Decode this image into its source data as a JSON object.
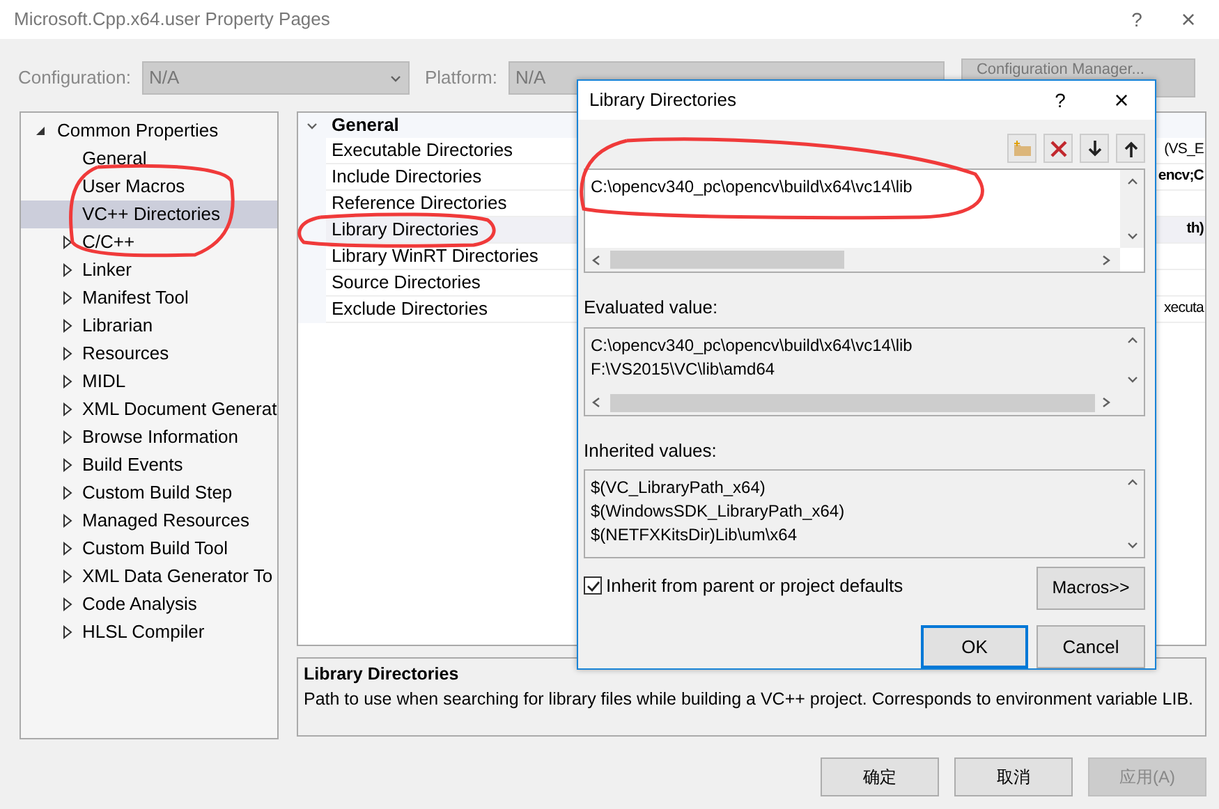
{
  "window": {
    "title": "Microsoft.Cpp.x64.user Property Pages",
    "help": "?",
    "close": "×"
  },
  "config_bar": {
    "configuration_label": "Configuration:",
    "configuration_value": "N/A",
    "platform_label": "Platform:",
    "platform_value": "N/A",
    "manager_button": "Configuration Manager...",
    "disabled": true
  },
  "tree": {
    "label": "Common Properties",
    "expanded": true,
    "children": [
      {
        "label": "General",
        "has_children": false,
        "selected": false
      },
      {
        "label": "User Macros",
        "has_children": false,
        "selected": false
      },
      {
        "label": "VC++ Directories",
        "has_children": false,
        "selected": true
      },
      {
        "label": "C/C++",
        "has_children": true,
        "selected": false
      },
      {
        "label": "Linker",
        "has_children": true,
        "selected": false
      },
      {
        "label": "Manifest Tool",
        "has_children": true,
        "selected": false
      },
      {
        "label": "Librarian",
        "has_children": true,
        "selected": false
      },
      {
        "label": "Resources",
        "has_children": true,
        "selected": false
      },
      {
        "label": "MIDL",
        "has_children": true,
        "selected": false
      },
      {
        "label": "XML Document Generat",
        "has_children": true,
        "selected": false
      },
      {
        "label": "Browse Information",
        "has_children": true,
        "selected": false
      },
      {
        "label": "Build Events",
        "has_children": true,
        "selected": false
      },
      {
        "label": "Custom Build Step",
        "has_children": true,
        "selected": false
      },
      {
        "label": "Managed Resources",
        "has_children": true,
        "selected": false
      },
      {
        "label": "Custom Build Tool",
        "has_children": true,
        "selected": false
      },
      {
        "label": "XML Data Generator To",
        "has_children": true,
        "selected": false
      },
      {
        "label": "Code Analysis",
        "has_children": true,
        "selected": false
      },
      {
        "label": "HLSL Compiler",
        "has_children": true,
        "selected": false
      }
    ]
  },
  "grid": {
    "category": "General",
    "expanded": true,
    "rows": [
      {
        "name": "Executable Directories",
        "value": "(VS_E",
        "bold": false,
        "selected": false
      },
      {
        "name": "Include Directories",
        "value": "encv;C",
        "bold": true,
        "selected": false
      },
      {
        "name": "Reference Directories",
        "selected": false
      },
      {
        "name": "Library Directories",
        "value": "th)",
        "bold": true,
        "selected": true
      },
      {
        "name": "Library WinRT Directories",
        "selected": false
      },
      {
        "name": "Source Directories",
        "selected": false
      },
      {
        "name": "Exclude Directories",
        "value": "xecuta",
        "bold": false,
        "selected": false
      }
    ]
  },
  "description": {
    "title": "Library Directories",
    "text": "Path to use when searching for library files while building a VC++ project.  Corresponds to environment variable LIB."
  },
  "buttons": [
    {
      "label": "确定",
      "disabled": false
    },
    {
      "label": "取消",
      "disabled": false
    },
    {
      "label": "应用(A)",
      "disabled": true
    }
  ],
  "dialog": {
    "title": "Library Directories",
    "help": "?",
    "close": "×",
    "entries": [
      "C:\\opencv340_pc\\opencv\\build\\x64\\vc14\\lib"
    ],
    "evaluated_label": "Evaluated value:",
    "evaluated": [
      "C:\\opencv340_pc\\opencv\\build\\x64\\vc14\\lib",
      "F:\\VS2015\\VC\\lib\\amd64"
    ],
    "inherited_label": "Inherited values:",
    "inherited": [
      "$(VC_LibraryPath_x64)",
      "$(WindowsSDK_LibraryPath_x64)",
      "$(NETFXKitsDir)Lib\\um\\x64"
    ],
    "inherit_checkbox": {
      "label": "Inherit from parent or project defaults",
      "checked": true
    },
    "macros_button": "Macros>>",
    "ok_button": "OK",
    "cancel_button": "Cancel"
  },
  "annotations": true
}
